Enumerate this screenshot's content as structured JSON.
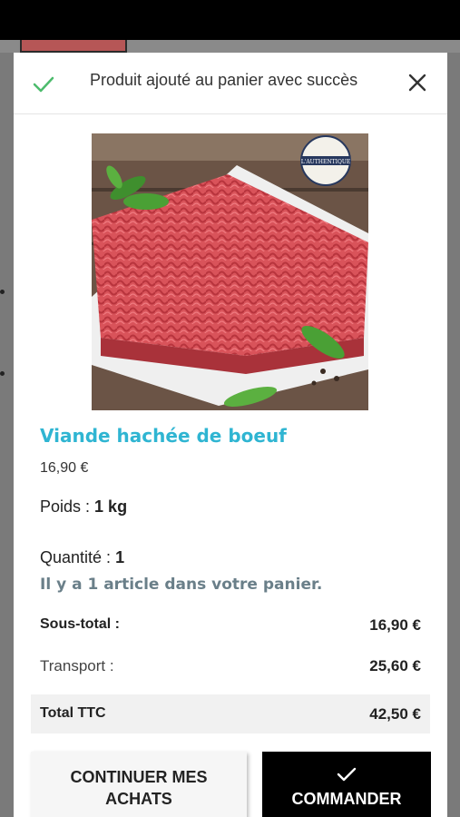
{
  "modal": {
    "header": {
      "title": "Produit ajouté au panier avec succès",
      "check_icon": "check-icon",
      "close_icon": "close-icon"
    },
    "product": {
      "name": "Viande hachée de boeuf",
      "price": "16,90 €",
      "weight_label": "Poids :",
      "weight_value": "1 kg",
      "quantity_label": "Quantité :",
      "quantity_value": "1",
      "image_badge_text": "L'AUTHENTIQUE"
    },
    "cart_count_text": "Il y a 1 article dans votre panier.",
    "summary": {
      "subtotal_label": "Sous-total :",
      "subtotal_value": "16,90 €",
      "transport_label": "Transport :",
      "transport_value": "25,60 €",
      "total_label": "Total TTC",
      "total_value": "42,50 €"
    },
    "buttons": {
      "continue_label_line1": "CONTINUER MES",
      "continue_label_line2": "ACHATS",
      "order_label": "COMMANDER"
    }
  },
  "colors": {
    "accent": "#2fb5d2",
    "success": "#4cbb6c",
    "cart_text": "#6a7f89",
    "order_bg": "#000000"
  }
}
